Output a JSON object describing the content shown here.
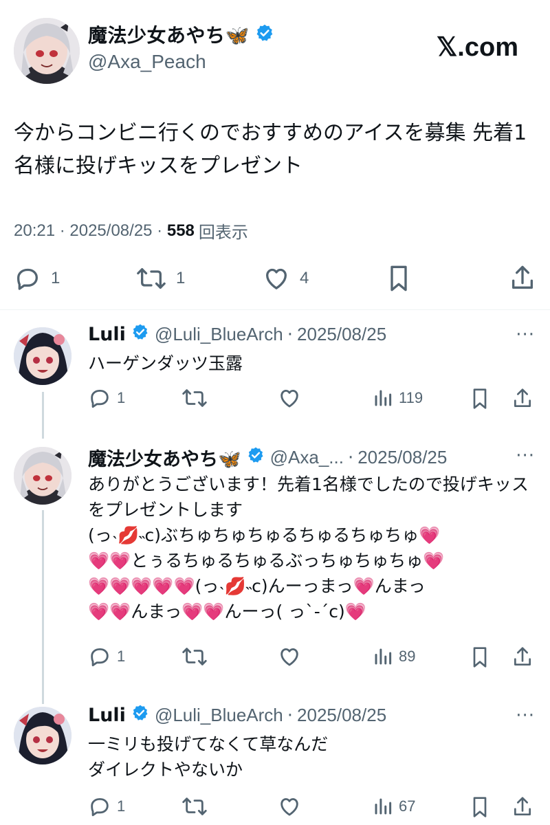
{
  "site": {
    "logo": "𝕏.com"
  },
  "main_tweet": {
    "name": "魔法少女あやち🦋",
    "handle": "@Axa_Peach",
    "text": "今からコンビニ行くのでおすすめのアイスを募集 先着1名様に投げキッスをプレゼント",
    "time": "20:21",
    "sep1": " · ",
    "date": "2025/08/25",
    "sep2": " · ",
    "views": "558",
    "views_label": "回表示",
    "actions": {
      "reply_count": "1",
      "retweet_count": "1",
      "like_count": "4"
    }
  },
  "replies": [
    {
      "name": "Luli",
      "handle": "@Luli_BlueArch",
      "dot": "·",
      "date": "2025/08/25",
      "more": "···",
      "text": "ハーゲンダッツ玉露",
      "reply_count": "1",
      "views": "119"
    },
    {
      "name": "魔法少女あやち🦋",
      "handle": "@Axa_...",
      "dot": "·",
      "date": "2025/08/25",
      "more": "···",
      "text": "ありがとうございます！先着1名様でしたので投げキッスをプレゼントします\n(っ˴💋˵c)ぶちゅちゅちゅるちゅるちゅちゅ💗\n💗💗とぅるちゅるちゅるぶっちゅちゅちゅ💗\n💗💗💗💗💗(っ˴💋˵c)んーっまっ💗んまっ\n💗💗んまっ💗💗んーっ( っ`-´c)💗",
      "reply_count": "1",
      "views": "89"
    },
    {
      "name": "Luli",
      "handle": "@Luli_BlueArch",
      "dot": "·",
      "date": "2025/08/25",
      "more": "···",
      "text": "一ミリも投げてなくて草なんだ\nダイレクトやないか",
      "reply_count": "1",
      "views": "67"
    }
  ],
  "colors": {
    "verified": "#1d9bf0",
    "muted": "#536471",
    "text": "#0f1419"
  }
}
